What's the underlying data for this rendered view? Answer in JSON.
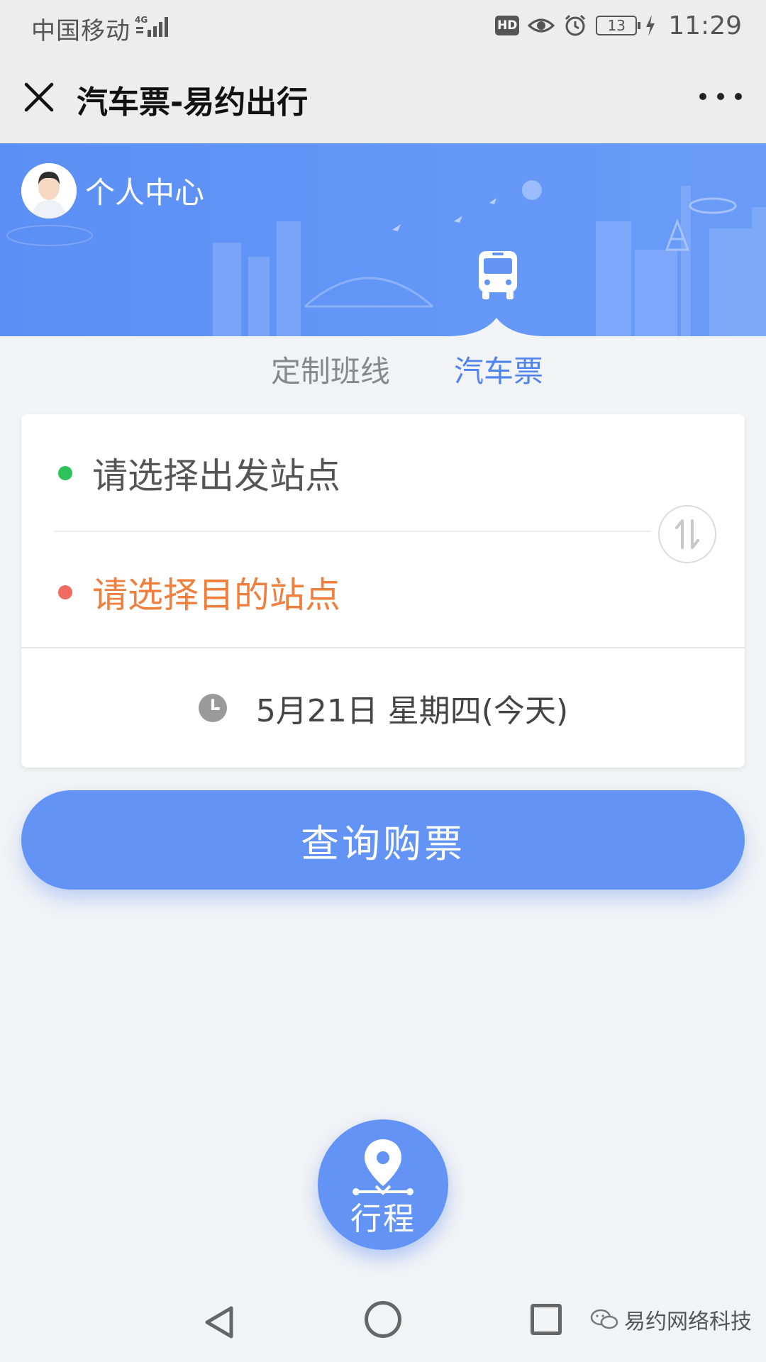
{
  "status_bar": {
    "carrier": "中国移动",
    "network": "4G",
    "hd": "HD",
    "battery": "13",
    "time": "11:29"
  },
  "nav_bar": {
    "title": "汽车票-易约出行"
  },
  "banner": {
    "user_center": "个人中心"
  },
  "tabs": [
    {
      "label": "定制班线",
      "active": false
    },
    {
      "label": "汽车票",
      "active": true
    }
  ],
  "form": {
    "departure_placeholder": "请选择出发站点",
    "destination_placeholder": "请选择目的站点",
    "date": "5月21日 星期四(今天)"
  },
  "search_button": {
    "label": "查询购票"
  },
  "trip_button": {
    "label": "行程"
  },
  "watermark": {
    "text": "易约网络科技"
  },
  "colors": {
    "primary": "#6293f5",
    "active_tab": "#4f84ee",
    "departure_dot": "#2dc35a",
    "destination_dot": "#f06a5f",
    "destination_text": "#f07f3e"
  }
}
